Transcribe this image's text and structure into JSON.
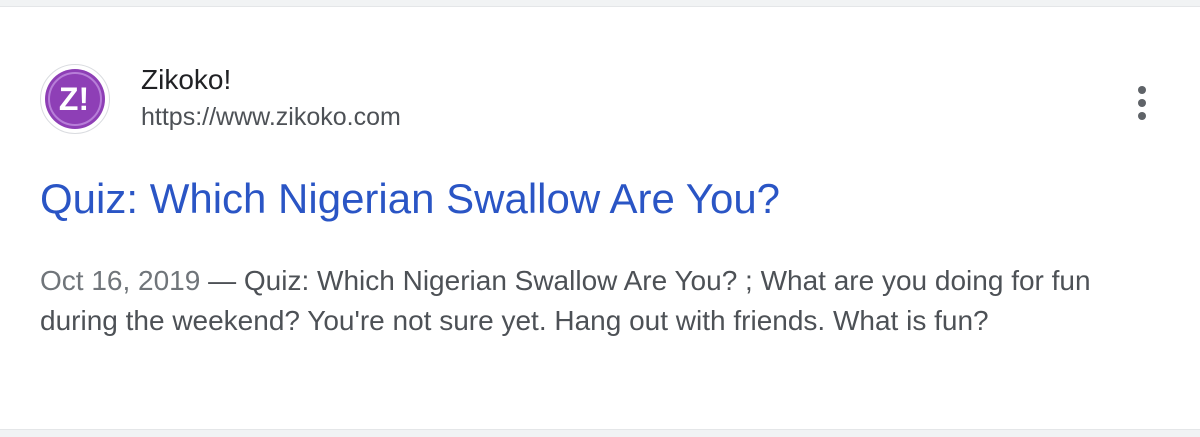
{
  "result": {
    "site_name": "Zikoko!",
    "site_url": "https://www.zikoko.com",
    "favicon": {
      "text": "Z!",
      "color": "#8e3fb6"
    },
    "more_icon": "three-dot-vertical",
    "title": "Quiz: Which Nigerian Swallow Are You?",
    "snippet_date": "Oct 16, 2019",
    "snippet_separator": " — ",
    "snippet_text": "Quiz: Which Nigerian Swallow Are You? ; What are you doing for fun during the weekend? You're not sure yet. Hang out with friends. What is fun?"
  },
  "colors": {
    "title_link": "#2a55c5",
    "body_text": "#4d5156",
    "site_name": "#202124",
    "background": "#f1f3f4"
  }
}
